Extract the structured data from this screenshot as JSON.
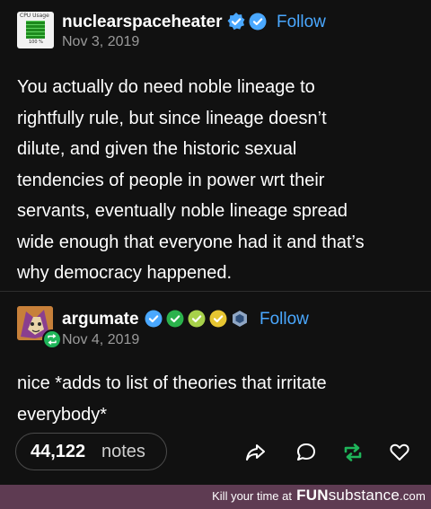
{
  "post1": {
    "username": "nuclearspaceheater",
    "date": "Nov 3, 2019",
    "follow_label": "Follow",
    "avatar_caption": "CPU Usage",
    "avatar_percent": "100 %",
    "body_lines": [
      "You actually do need noble lineage to",
      "rightfully rule, but since lineage doesn’t",
      "dilute, and given the historic sexual",
      "tendencies of people in power wrt their",
      "servants, eventually noble lineage spread",
      "wide enough that everyone had it and that’s",
      "why democracy happened."
    ]
  },
  "post2": {
    "username": "argumate",
    "date": "Nov 4, 2019",
    "follow_label": "Follow",
    "body_lines": [
      "nice *adds to list of theories that irritate",
      "everybody*"
    ]
  },
  "notes": {
    "count": "44,122",
    "label": "notes"
  },
  "actions": [
    "share-icon",
    "reply-icon",
    "reblog-icon",
    "like-icon"
  ],
  "footer": {
    "tagline": "Kill your time at",
    "brand_bold": "FUN",
    "brand_light": "substance",
    "brand_domain": ".com"
  },
  "colors": {
    "background": "#111111",
    "follow": "#4aa8ff",
    "footer": "#5e3b52",
    "reblog": "#1fb55a"
  }
}
